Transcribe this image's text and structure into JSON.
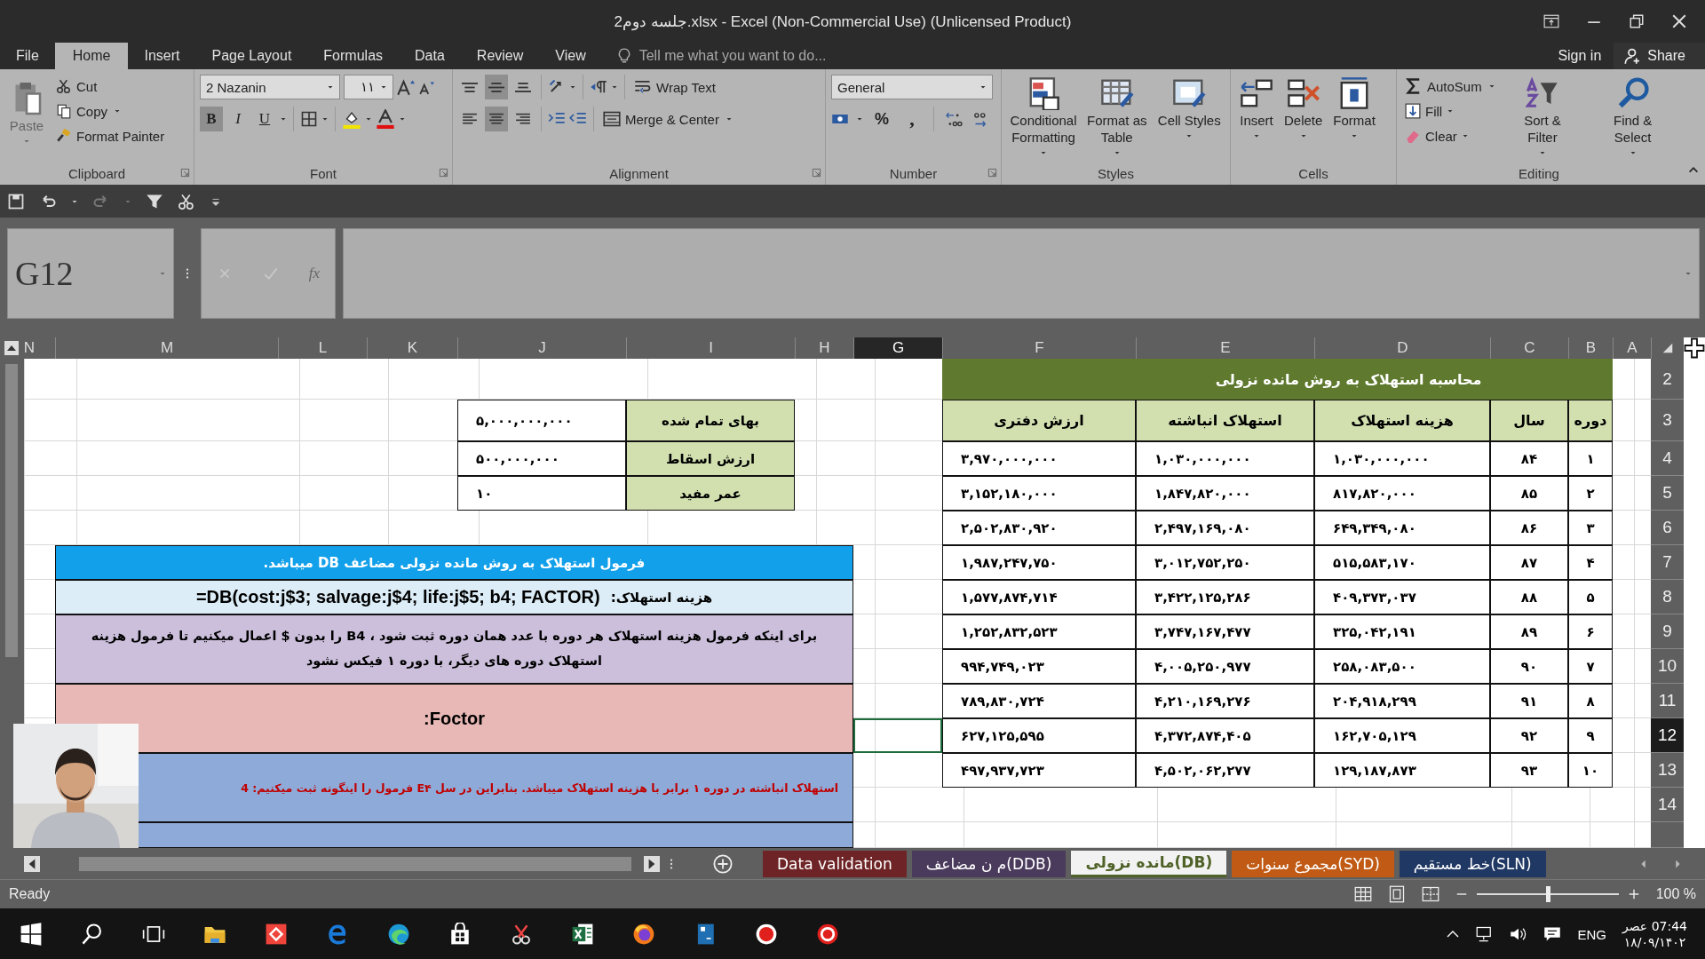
{
  "window": {
    "title": "جلسه دوم2.xlsx - Excel (Non-Commercial Use) (Unlicensed Product)"
  },
  "ribbon_tabs": [
    {
      "label": "View",
      "selected": false
    },
    {
      "label": "Review",
      "selected": false
    },
    {
      "label": "Data",
      "selected": false
    },
    {
      "label": "Formulas",
      "selected": false
    },
    {
      "label": "Page Layout",
      "selected": false
    },
    {
      "label": "Insert",
      "selected": false
    },
    {
      "label": "Home",
      "selected": true
    },
    {
      "label": "File",
      "selected": false
    }
  ],
  "tell_me": {
    "placeholder": "Tell me what you want to do..."
  },
  "account": {
    "sign_in": "Sign in",
    "share": "Share"
  },
  "ribbon": {
    "clipboard": {
      "label": "Clipboard",
      "paste": "Paste",
      "cut": "Cut",
      "copy": "Copy",
      "format_painter": "Format Painter"
    },
    "font": {
      "label": "Font",
      "font_name": "2  Nazanin",
      "font_size": "۱۱",
      "bold": {
        "label": "B",
        "on": true
      },
      "italic": {
        "label": "I",
        "on": false
      },
      "underline": {
        "label": "U",
        "on": false
      }
    },
    "alignment": {
      "label": "Alignment",
      "vertical": [
        {
          "selected": false
        },
        {
          "selected": true
        },
        {
          "selected": false
        }
      ],
      "horizontal": [
        {
          "selected": false
        },
        {
          "selected": true
        },
        {
          "selected": false
        }
      ],
      "wrap_text": "Wrap Text",
      "merge_center": "Merge & Center"
    },
    "number": {
      "label": "Number",
      "format": "General",
      "percent": "%",
      "comma": ","
    },
    "styles": {
      "label": "Styles",
      "buttons": [
        "Cell Styles",
        "Format as Table",
        "Conditional Formatting"
      ]
    },
    "cells": {
      "label": "Cells",
      "buttons": [
        "Format",
        "Delete",
        "Insert"
      ]
    },
    "editing": {
      "label": "Editing",
      "autosum": "AutoSum",
      "fill": "Fill",
      "clear": "Clear",
      "sort_filter": "Sort & Filter",
      "find_select": "Find & Select"
    }
  },
  "formula_bar": {
    "name_box": "G12",
    "fx": "fx"
  },
  "columns": [
    {
      "label": "A",
      "selected": false
    },
    {
      "label": "B",
      "selected": false
    },
    {
      "label": "C",
      "selected": false
    },
    {
      "label": "D",
      "selected": false
    },
    {
      "label": "E",
      "selected": false
    },
    {
      "label": "F",
      "selected": false
    },
    {
      "label": "G",
      "selected": true
    },
    {
      "label": "H",
      "selected": false
    },
    {
      "label": "I",
      "selected": false
    },
    {
      "label": "J",
      "selected": false
    },
    {
      "label": "K",
      "selected": false
    },
    {
      "label": "L",
      "selected": false
    },
    {
      "label": "M",
      "selected": false
    },
    {
      "label": "N",
      "selected": false
    }
  ],
  "rows": [
    {
      "label": "2",
      "selected": false
    },
    {
      "label": "3",
      "selected": false
    },
    {
      "label": "4",
      "selected": false
    },
    {
      "label": "5",
      "selected": false
    },
    {
      "label": "6",
      "selected": false
    },
    {
      "label": "7",
      "selected": false
    },
    {
      "label": "8",
      "selected": false
    },
    {
      "label": "9",
      "selected": false
    },
    {
      "label": "10",
      "selected": false
    },
    {
      "label": "11",
      "selected": false
    },
    {
      "label": "12",
      "selected": true
    },
    {
      "label": "13",
      "selected": false
    },
    {
      "label": "14",
      "selected": false
    }
  ],
  "depreciation_table": {
    "title": "محاسبه استهلاک به روش مانده نزولی",
    "columns": [
      "دوره",
      "سال",
      "هزینه استهلاک",
      "استهلاک انباشته",
      "ارزش دفتری"
    ],
    "rows": [
      [
        "۱",
        "۸۴",
        "۱,۰۳۰,۰۰۰,۰۰۰",
        "۱,۰۳۰,۰۰۰,۰۰۰",
        "۳,۹۷۰,۰۰۰,۰۰۰"
      ],
      [
        "۲",
        "۸۵",
        "۸۱۷,۸۲۰,۰۰۰",
        "۱,۸۴۷,۸۲۰,۰۰۰",
        "۳,۱۵۲,۱۸۰,۰۰۰"
      ],
      [
        "۳",
        "۸۶",
        "۶۴۹,۳۴۹,۰۸۰",
        "۲,۴۹۷,۱۶۹,۰۸۰",
        "۲,۵۰۲,۸۳۰,۹۲۰"
      ],
      [
        "۴",
        "۸۷",
        "۵۱۵,۵۸۳,۱۷۰",
        "۳,۰۱۲,۷۵۲,۲۵۰",
        "۱,۹۸۷,۲۴۷,۷۵۰"
      ],
      [
        "۵",
        "۸۸",
        "۴۰۹,۳۷۳,۰۳۷",
        "۳,۴۲۲,۱۲۵,۲۸۶",
        "۱,۵۷۷,۸۷۴,۷۱۴"
      ],
      [
        "۶",
        "۸۹",
        "۳۲۵,۰۴۲,۱۹۱",
        "۳,۷۴۷,۱۶۷,۴۷۷",
        "۱,۲۵۲,۸۳۲,۵۲۳"
      ],
      [
        "۷",
        "۹۰",
        "۲۵۸,۰۸۳,۵۰۰",
        "۴,۰۰۵,۲۵۰,۹۷۷",
        "۹۹۴,۷۴۹,۰۲۳"
      ],
      [
        "۸",
        "۹۱",
        "۲۰۴,۹۱۸,۲۹۹",
        "۴,۲۱۰,۱۶۹,۲۷۶",
        "۷۸۹,۸۳۰,۷۲۴"
      ],
      [
        "۹",
        "۹۲",
        "۱۶۲,۷۰۵,۱۲۹",
        "۴,۳۷۲,۸۷۴,۴۰۵",
        "۶۲۷,۱۲۵,۵۹۵"
      ],
      [
        "۱۰",
        "۹۳",
        "۱۲۹,۱۸۷,۸۷۳",
        "۴,۵۰۲,۰۶۲,۲۷۷",
        "۴۹۷,۹۳۷,۷۲۳"
      ]
    ]
  },
  "inputs": [
    {
      "label": "بهای تمام شده",
      "value": "۵,۰۰۰,۰۰۰,۰۰۰"
    },
    {
      "label": "ارزش اسقاط",
      "value": "۵۰۰,۰۰۰,۰۰۰"
    },
    {
      "label": "عمر مفید",
      "value": "۱۰"
    }
  ],
  "notes": [
    {
      "kind": "heading",
      "text": "فرمول استهلاک به روش مانده نزولی مضاعف DB میباشد."
    },
    {
      "kind": "formula",
      "label": "هزینه استهلاک:",
      "formula": "=DB(cost:j$3; salvage:j$4; life:j$5; b4; FACTOR)"
    },
    {
      "kind": "explanation",
      "text": "برای اینکه فرمول هزینه استهلاک هر دوره با عدد همان دوره ثبت شود ، B4 را بدون $ اعمال میکنیم تا فرمول هزینه استهلاک دوره های دیگر، با دوره ۱ فیکس نشود"
    },
    {
      "kind": "factor",
      "text": "Foctor:"
    },
    {
      "kind": "remark",
      "text": "استهلاک انباشته در دوره ۱ برابر با هزینه استهلاک میباشد. بنابراین در سل E۴ فرمول را اینگونه ثبت میکنیم: 4"
    },
    {
      "kind": "band"
    }
  ],
  "sheet_tabs": [
    {
      "label": "خط مستقیم(SLN)",
      "color": "#203864",
      "selected": false
    },
    {
      "label": "مجموع سنوات(SYD)",
      "color": "#c05a14",
      "selected": false
    },
    {
      "label": "مانده نزولی(DB)",
      "color": "#4f6228",
      "selected": true
    },
    {
      "label": "م ن مضاعف(DDB)",
      "color": "#4a3a5c",
      "selected": false
    },
    {
      "label": "Data validation",
      "color": "#6e2426",
      "selected": false
    }
  ],
  "status_bar": {
    "status": "Ready",
    "zoom": {
      "level": 0.5,
      "reading": "100 %"
    }
  },
  "taskbar": {
    "language": "ENG",
    "time": "07:44 عصر",
    "date": "۱۸/۰۹/۱۴۰۲"
  }
}
